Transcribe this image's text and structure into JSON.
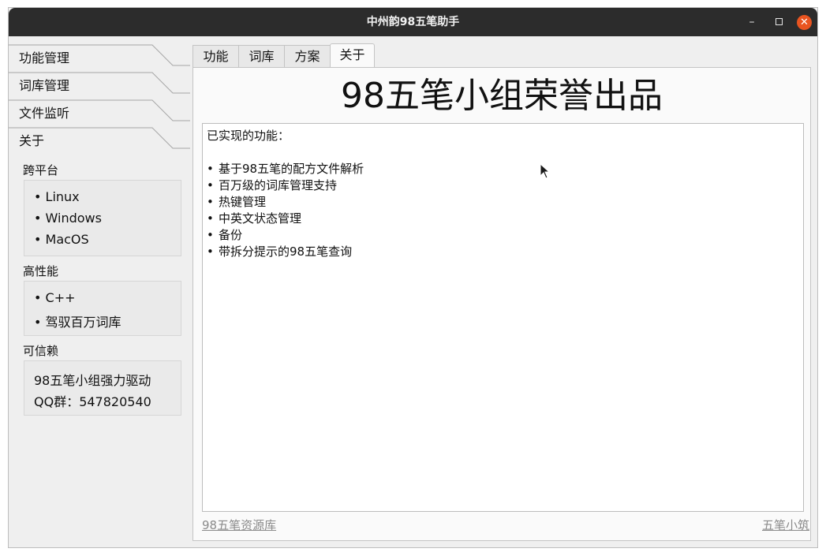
{
  "window": {
    "title": "中州韵98五笔助手"
  },
  "controls": {
    "minimize": "–",
    "close": "✕"
  },
  "sidebar": {
    "items": [
      {
        "label": "功能管理"
      },
      {
        "label": "词库管理"
      },
      {
        "label": "文件监听"
      },
      {
        "label": "关于"
      }
    ],
    "groups": [
      {
        "title": "跨平台",
        "lines": [
          "• Linux",
          "• Windows",
          "• MacOS"
        ]
      },
      {
        "title": "高性能",
        "lines": [
          "• C++",
          "• 驾驭百万词库"
        ]
      },
      {
        "title": "可信赖",
        "lines": [
          "98五笔小组强力驱动",
          "QQ群：547820540"
        ]
      }
    ]
  },
  "tabs": [
    {
      "label": "功能",
      "active": false
    },
    {
      "label": "词库",
      "active": false
    },
    {
      "label": "方案",
      "active": false
    },
    {
      "label": "关于",
      "active": true
    }
  ],
  "about": {
    "headline": "98五笔小组荣誉出品",
    "intro": "已实现的功能：",
    "bullet": "•",
    "features": [
      "基于98五笔的配方文件解析",
      "百万级的词库管理支持",
      "热键管理",
      "中英文状态管理",
      "备份",
      "带拆分提示的98五笔查询"
    ],
    "link_left": "98五笔资源库",
    "link_right": "五笔小筑"
  }
}
